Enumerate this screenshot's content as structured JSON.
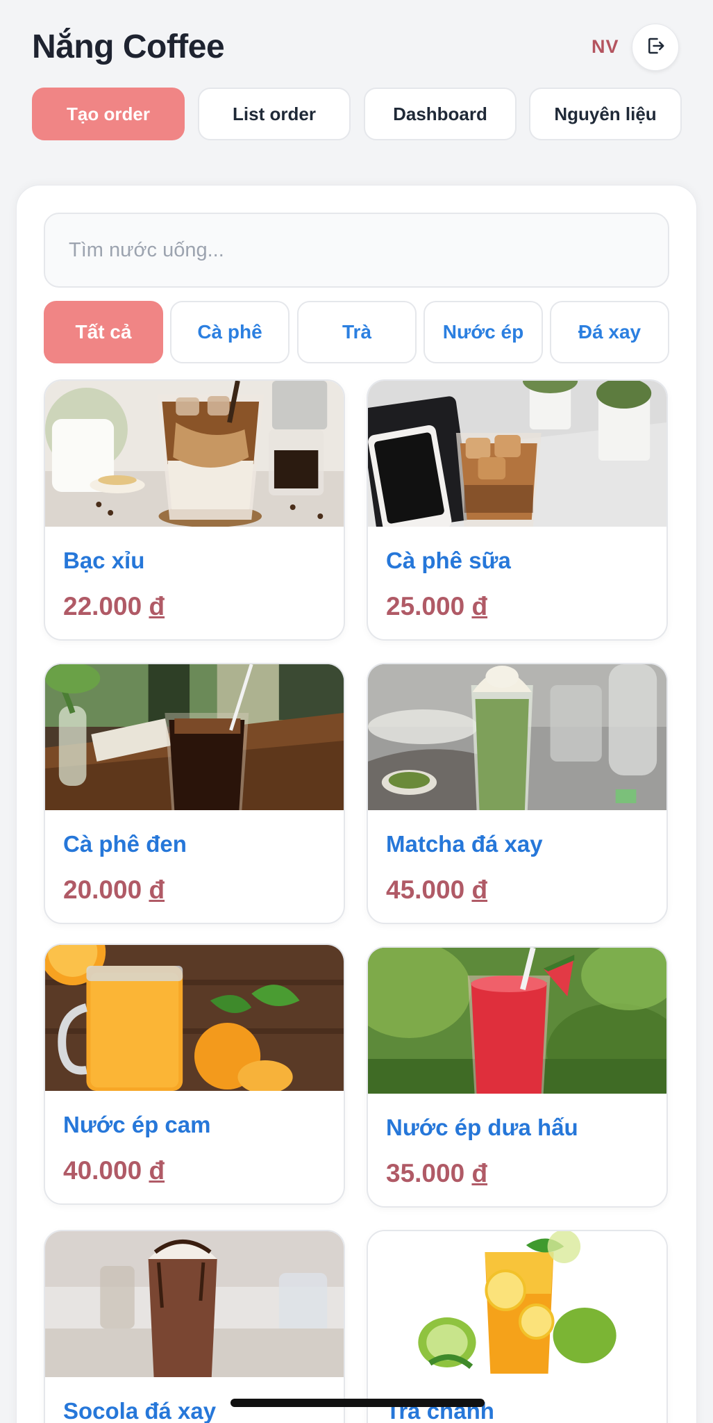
{
  "header": {
    "title": "Nắng Coffee",
    "user_initials": "NV"
  },
  "nav": {
    "tabs": [
      {
        "label": "Tạo order",
        "active": true
      },
      {
        "label": "List order",
        "active": false
      },
      {
        "label": "Dashboard",
        "active": false
      },
      {
        "label": "Nguyên liệu",
        "active": false
      }
    ]
  },
  "search": {
    "placeholder": "Tìm nước uống...",
    "value": ""
  },
  "categories": [
    {
      "label": "Tất cả",
      "active": true
    },
    {
      "label": "Cà phê",
      "active": false
    },
    {
      "label": "Trà",
      "active": false
    },
    {
      "label": "Nước ép",
      "active": false
    },
    {
      "label": "Đá xay",
      "active": false
    }
  ],
  "products": [
    {
      "name": "Bạc xỉu",
      "price": "22.000",
      "currency": "đ",
      "image_icon": "iced-milk-coffee-photo"
    },
    {
      "name": "Cà phê sữa",
      "price": "25.000",
      "currency": "đ",
      "image_icon": "iced-coffee-photo"
    },
    {
      "name": "Cà phê đen",
      "price": "20.000",
      "currency": "đ",
      "image_icon": "black-coffee-photo"
    },
    {
      "name": "Matcha đá xay",
      "price": "45.000",
      "currency": "đ",
      "image_icon": "matcha-frappe-photo"
    },
    {
      "name": "Nước ép cam",
      "price": "40.000",
      "currency": "đ",
      "image_icon": "orange-juice-photo"
    },
    {
      "name": "Nước ép dưa hấu",
      "price": "35.000",
      "currency": "đ",
      "image_icon": "watermelon-juice-photo"
    },
    {
      "name": "Socola đá xay",
      "price": "",
      "currency": "",
      "image_icon": "chocolate-frappe-photo"
    },
    {
      "name": "Trà chanh",
      "price": "",
      "currency": "",
      "image_icon": "lemon-tea-photo"
    }
  ],
  "colors": {
    "accent": "#f08585",
    "product_name": "#2677d9",
    "price": "#b05a66",
    "background": "#f3f4f6"
  }
}
